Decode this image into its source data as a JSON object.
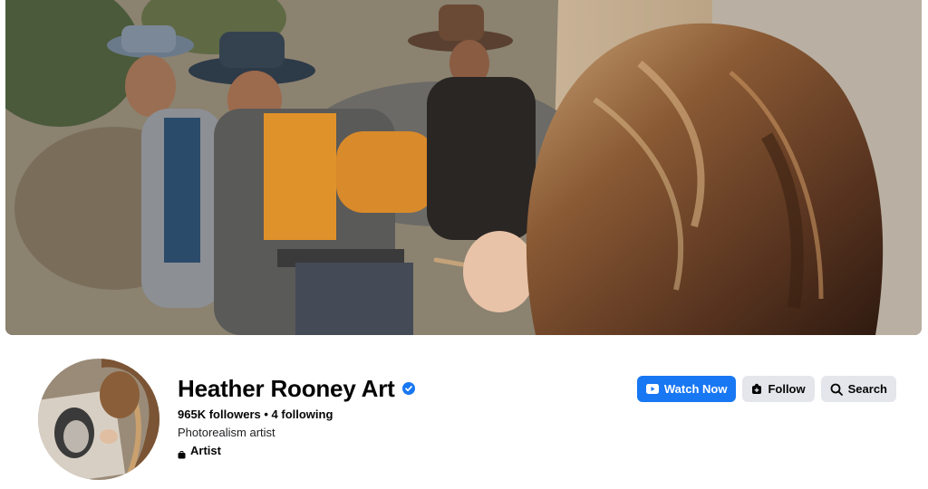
{
  "profile": {
    "name": "Heather Rooney Art",
    "verified": true,
    "stats": "965K followers • 4 following",
    "bio": "Photorealism artist",
    "category": "Artist"
  },
  "actions": {
    "watch_now": "Watch Now",
    "follow": "Follow",
    "search": "Search"
  },
  "icons": {
    "verified": "verified-badge-icon",
    "category": "briefcase-icon",
    "watch": "video-play-icon",
    "follow": "follow-icon",
    "search": "search-icon"
  },
  "colors": {
    "primary": "#1877f2",
    "secondary_button": "#e4e6eb",
    "text": "#050505"
  }
}
